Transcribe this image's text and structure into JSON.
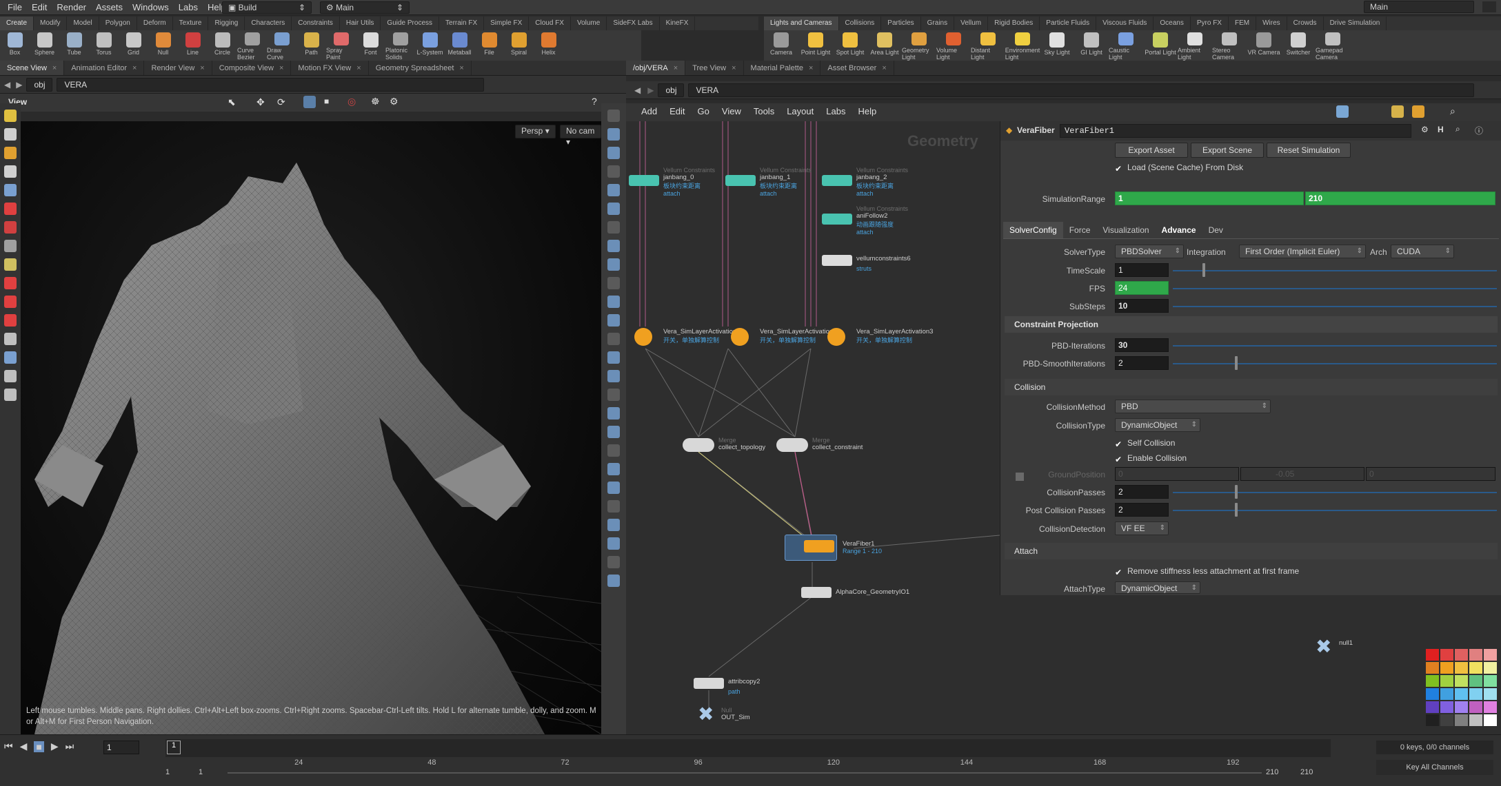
{
  "menubar": {
    "items": [
      "File",
      "Edit",
      "Render",
      "Assets",
      "Windows",
      "Labs",
      "Help"
    ],
    "desktop": "Build",
    "context": "Main",
    "right_context": "Main"
  },
  "shelf_left": {
    "tabs": [
      "Create",
      "Modify",
      "Model",
      "Polygon",
      "Deform",
      "Texture",
      "Rigging",
      "Characters",
      "Constraints",
      "Hair Utils",
      "Guide Process",
      "Terrain FX",
      "Simple FX",
      "Cloud FX",
      "Volume",
      "SideFX Labs",
      "KineFX"
    ],
    "tools": [
      "Box",
      "Sphere",
      "Tube",
      "Torus",
      "Grid",
      "Null",
      "Line",
      "Circle",
      "Curve Bezier",
      "Draw Curve",
      "Path",
      "Spray Paint",
      "Font",
      "Platonic Solids",
      "L-System",
      "Metaball",
      "File",
      "Spiral",
      "Helix"
    ]
  },
  "shelf_right": {
    "tabs": [
      "Lights and Cameras",
      "Collisions",
      "Particles",
      "Grains",
      "Vellum",
      "Rigid Bodies",
      "Particle Fluids",
      "Viscous Fluids",
      "Oceans",
      "Pyro FX",
      "FEM",
      "Wires",
      "Crowds",
      "Drive Simulation"
    ],
    "tools": [
      "Camera",
      "Point Light",
      "Spot Light",
      "Area Light",
      "Geometry Light",
      "Volume Light",
      "Distant Light",
      "Environment Light",
      "Sky Light",
      "GI Light",
      "Caustic Light",
      "Portal Light",
      "Ambient Light",
      "Stereo Camera",
      "VR Camera",
      "Switcher",
      "Gamepad Camera"
    ]
  },
  "left_pane": {
    "tabs": [
      "Scene View",
      "Animation Editor",
      "Render View",
      "Composite View",
      "Motion FX View",
      "Geometry Spreadsheet"
    ],
    "path_root": "obj",
    "path_node": "VERA",
    "view_label": "View",
    "persp": "Persp",
    "cam": "No cam",
    "hint": "Left mouse tumbles. Middle pans. Right dollies. Ctrl+Alt+Left box-zooms. Ctrl+Right zooms. Spacebar-Ctrl-Left tilts. Hold L for alternate tumble, dolly, and zoom.    M or Alt+M for First Person Navigation."
  },
  "right_pane": {
    "tabs": [
      "/obj/VERA",
      "Tree View",
      "Material Palette",
      "Asset Browser"
    ],
    "path_root": "obj",
    "path_node": "VERA",
    "menu": [
      "Add",
      "Edit",
      "Go",
      "View",
      "Tools",
      "Layout",
      "Labs",
      "Help"
    ],
    "context_label": "Geometry"
  },
  "nodes": {
    "c0": {
      "type": "Vellum Constraints",
      "name": "janbang_0",
      "cn": "板块约束距离",
      "sub": "attach"
    },
    "c1": {
      "type": "Vellum Constraints",
      "name": "janbang_1",
      "cn": "板块约束距离",
      "sub": "attach"
    },
    "c2": {
      "type": "Vellum Constraints",
      "name": "janbang_2",
      "cn": "板块约束距离",
      "sub": "attach"
    },
    "follow": {
      "type": "Vellum Constraints",
      "name": "aniFollow2",
      "cn": "动画跟随强度",
      "sub": "attach"
    },
    "vc6": {
      "name": "vellumconstraints6",
      "sub": "struts"
    },
    "a1": {
      "name": "Vera_SimLayerActivation",
      "cn": "开关，单独解算控制"
    },
    "a2": {
      "name": "Vera_SimLayerActivation",
      "cn": "开关，单独解算控制"
    },
    "a3": {
      "name": "Vera_SimLayerActivation3",
      "cn": "开关，单独解算控制"
    },
    "m1": {
      "type": "Merge",
      "name": "collect_topology"
    },
    "m2": {
      "type": "Merge",
      "name": "collect_constraint"
    },
    "fiber": {
      "name": "VeraFiber1",
      "sub": "Range 1 - 210"
    },
    "alpha": {
      "name": "AlphaCore_GeometryIO1"
    },
    "null1": {
      "name": "null1"
    },
    "copy": {
      "name": "attribcopy2",
      "sub": "path"
    },
    "out": {
      "type": "Null",
      "name": "OUT_Sim"
    }
  },
  "params": {
    "node_type": "VeraFiber",
    "node_name": "VeraFiber1",
    "buttons": [
      "Export Asset",
      "Export Scene",
      "Reset Simulation"
    ],
    "load_cache": "Load (Scene Cache) From Disk",
    "sim_range_label": "SimulationRange",
    "sim_range": [
      "1",
      "210"
    ],
    "tabs": [
      "SolverConfig",
      "Force",
      "Visualization",
      "Advance",
      "Dev"
    ],
    "solver_type_label": "SolverType",
    "solver_type": "PBDSolver",
    "integration_label": "Integration",
    "integration": "First Order (Implicit Euler)",
    "arch_label": "Arch",
    "arch": "CUDA",
    "timescale_label": "TimeScale",
    "timescale": "1",
    "fps_label": "FPS",
    "fps": "24",
    "substeps_label": "SubSteps",
    "substeps": "10",
    "constraint_section": "Constraint Projection",
    "pbd_iter_label": "PBD-Iterations",
    "pbd_iter": "30",
    "pbd_smooth_label": "PBD-SmoothIterations",
    "pbd_smooth": "2",
    "collision_section": "Collision",
    "coll_method_label": "CollisionMethod",
    "coll_method": "PBD",
    "coll_type_label": "CollisionType",
    "coll_type": "DynamicObject",
    "self_collision": "Self Collision",
    "enable_collision": "Enable Collision",
    "ground_label": "GroundPosition",
    "ground": [
      "0",
      "-0.05",
      "0"
    ],
    "coll_passes_label": "CollisionPasses",
    "coll_passes": "2",
    "post_coll_label": "Post Collision Passes",
    "post_coll": "2",
    "coll_detect_label": "CollisionDetection",
    "coll_detect": "VF EE",
    "attach_section": "Attach",
    "remove_stiff": "Remove stiffness less attachment at first frame",
    "attach_type_label": "AttachType",
    "attach_type": "DynamicObject"
  },
  "timeline": {
    "frame": "1",
    "ticks": [
      "1",
      "24",
      "48",
      "72",
      "96",
      "120",
      "144",
      "168",
      "192"
    ],
    "range_start": "1",
    "range_start2": "1",
    "range_end": "210",
    "range_end2": "210",
    "keys": "0 keys, 0/0 channels",
    "key_all": "Key All Channels"
  },
  "colors": {
    "accent_green": "#2fa84a",
    "node_teal": "#49c3b0",
    "node_orange": "#f0a020",
    "selection_blue": "#4aa3df"
  }
}
